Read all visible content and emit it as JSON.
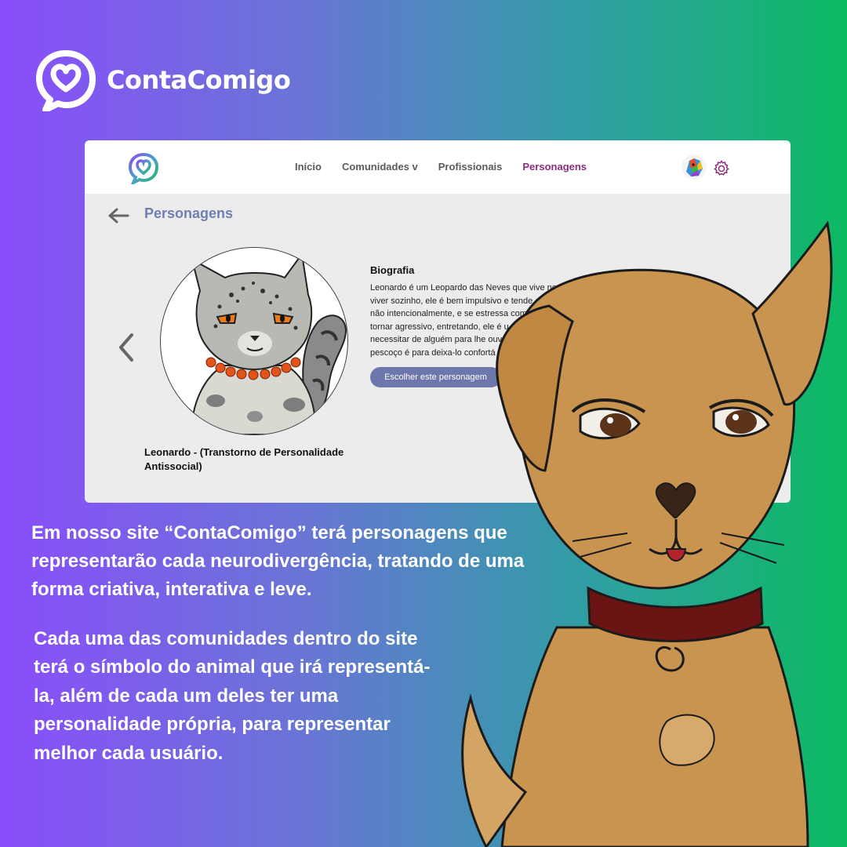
{
  "brand": {
    "name": "ContaComigo"
  },
  "nav": {
    "links": [
      {
        "label": "Início"
      },
      {
        "label": "Comunidades v"
      },
      {
        "label": "Profissionais"
      },
      {
        "label": "Personagens"
      }
    ],
    "active_index": 3,
    "active_color": "#8b2d7e"
  },
  "page": {
    "title": "Personagens"
  },
  "character": {
    "name": "Leonardo - (Transtorno de Personalidade Antissocial)",
    "bio_title": "Biografia",
    "bio_lines": [
      "Leonardo é um Leopardo das Neves que vive no alto das montanhas geladas, ele prefere",
      "viver sozinho, ele é bem impulsivo e tende a ser rude às",
      "não intencionalmente, e se estressa com",
      "tornar agressivo, entretando, ele é u",
      "necessitar de alguém para lhe ouv",
      "pescoço é para deixa-lo confortá"
    ],
    "choose_button": "Escolher este personagem"
  },
  "captions": {
    "first": "Em nosso site “ContaComigo” terá personagens que representarão cada neurodivergência, tratando de uma forma criativa, interativa e leve.",
    "second": "Cada uma das comunidades dentro do site terá o símbolo do animal que irá representá-la, além de cada um deles ter uma personalidade própria, para representar melhor cada usuário."
  },
  "icons": {
    "brand": "speech-heart-icon",
    "back": "arrow-left-icon",
    "prev": "chevron-left-icon",
    "settings": "gear-icon"
  },
  "colors": {
    "gradient_start": "#8a4dfb",
    "gradient_end": "#0cba62",
    "title": "#6f7fb2",
    "button": "#6d77ab"
  }
}
